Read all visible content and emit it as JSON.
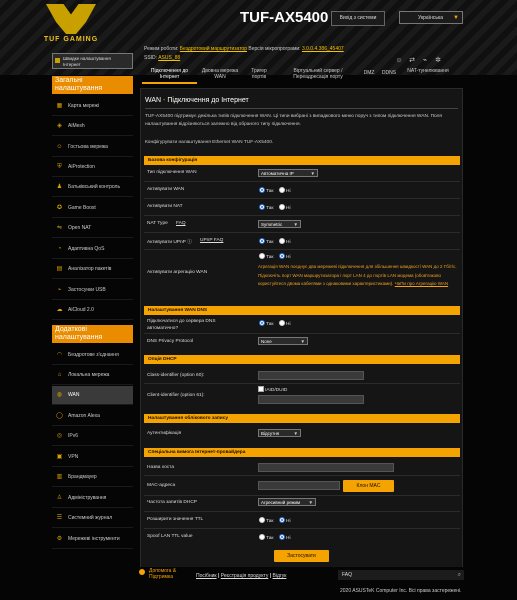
{
  "header": {
    "brand": "TUF GAMING",
    "model": "TUF-AX5400",
    "logout_label": "Вихід з системи",
    "language": "Українська",
    "mode_label": "Режим роботи:",
    "mode_value": "Бездротовий маршрутизатор",
    "fw_label": "Версія мікропрограми:",
    "fw_value": "3.0.0.4.386_45407",
    "ssid_label": "SSID:",
    "ssid_value": "ASUS_88"
  },
  "tabs": [
    {
      "label": "Підключення до Інтернет"
    },
    {
      "label": "Двовна мережа WAN"
    },
    {
      "label": "Тригер портів"
    },
    {
      "label": "Віртуальний сервер / Переадресація порту"
    },
    {
      "label": "DMZ"
    },
    {
      "label": "DDNS"
    },
    {
      "label": "NAT-тунелювання"
    }
  ],
  "sidebar": {
    "quick_setup": "Швидке налаштування Інтернет",
    "general_title": "Загальні налаштування",
    "general_items": [
      {
        "label": "Карта мережі",
        "icon": "map-icon"
      },
      {
        "label": "AiMesh",
        "icon": "mesh-icon"
      },
      {
        "label": "Гостьова мережа",
        "icon": "guest-icon"
      },
      {
        "label": "AiProtection",
        "icon": "shield-icon"
      },
      {
        "label": "Батьківський контроль",
        "icon": "parental-icon"
      },
      {
        "label": "Game Boost",
        "icon": "gamepad-icon"
      },
      {
        "label": "Open NAT",
        "icon": "nat-icon"
      },
      {
        "label": "Адаптивна QoS",
        "icon": "qos-icon"
      },
      {
        "label": "Аналізатор пакетів",
        "icon": "traffic-icon"
      },
      {
        "label": "Застосунки USB",
        "icon": "usb-icon"
      },
      {
        "label": "AiCloud 2.0",
        "icon": "cloud-icon"
      }
    ],
    "advanced_title": "Додаткові налаштування",
    "advanced_items": [
      {
        "label": "Бездротове з'єднання",
        "icon": "wireless-icon"
      },
      {
        "label": "Локальна мережа",
        "icon": "lan-icon"
      },
      {
        "label": "WAN",
        "icon": "globe-icon"
      },
      {
        "label": "Amazon Alexa",
        "icon": "alexa-icon"
      },
      {
        "label": "IPv6",
        "icon": "ipv6-icon"
      },
      {
        "label": "VPN",
        "icon": "vpn-icon"
      },
      {
        "label": "Брандмауер",
        "icon": "firewall-icon"
      },
      {
        "label": "Адміністрування",
        "icon": "admin-icon"
      },
      {
        "label": "Системний журнал",
        "icon": "log-icon"
      },
      {
        "label": "Мережеві інструменти",
        "icon": "tools-icon"
      }
    ]
  },
  "page": {
    "title_prefix": "WAN",
    "title_sep": " - ",
    "title": "Підключення до Інтернет",
    "desc": "TUF-AX5400 підтримує декілька типів підключення WAN. Ці типи вибрані з випадкового меню поруч з типом підключення WAN. Поля налаштування відрізняються залежно від обраного типу підключення.",
    "desc2": "Конфігурувати налаштування Ethernet WAN TUF-AX5400."
  },
  "basic": {
    "header": "Базова конфігурація",
    "wan_type_label": "Тип підключення WAN",
    "wan_type_value": "Автоматична IP",
    "enable_wan_label": "Активувати WAN",
    "enable_nat_label": "Активувати NAT",
    "nat_type_label": "NAT Type",
    "nat_faq": "FAQ",
    "nat_type_value": "Symmetric",
    "upnp_label": "Активувати UPnP",
    "upnp_faq": "UPnP FAQ",
    "aggregation_label": "Активувати агрегацію WAN",
    "yes": "Так",
    "no": "Ні",
    "note": "Агрегація WAN поєднує два мережеві підключення для збільшення швидкості WAN до 2 Гбіт/с. Підключіть порт WAN маршрутизатора і порт LAN 4 до портів LAN модема (обов'язково користуйтеся двома кабелями з однаковими характеристиками).",
    "note_link": "ЧаПи про Агрегацію WAN"
  },
  "dns": {
    "header": "Налаштування WAN DNS",
    "auto_label": "Підключатися до сервера DNS автоматично?",
    "privacy_label": "DNS Privacy Protocol",
    "privacy_value": "None"
  },
  "dhcp": {
    "header": "Опція DHCP",
    "class_id_label": "Class-identifier (option 60):",
    "client_id_label": "Client-identifier (option 61):",
    "iaid_label": "IAID/DUID"
  },
  "account": {
    "header": "Налаштування облікового запису",
    "auth_label": "Аутентифікація",
    "auth_value": "Відсутня"
  },
  "isp": {
    "header": "Спеціальна вимога Інтернет-провайдера",
    "host_label": "Назва хоста",
    "mac_label": "MAC-адреса",
    "mac_button": "Клон MAC",
    "dhcp_freq_label": "Частота запитів DHCP",
    "dhcp_freq_value": "Агресивний режим",
    "ttl_label": "Розширити значення TTL",
    "spoof_label": "Spoof LAN TTL value"
  },
  "apply_label": "Застосувати",
  "footer": {
    "help": "Допомога & Підтримка",
    "link1": "Посібник",
    "sep": " | ",
    "link2": "Реєстрація продукту",
    "link3": "Відгук",
    "faq": "FAQ",
    "copyright": "2020 ASUSTeK Computer Inc. Всі права застережені."
  },
  "colors": {
    "accent": "#f5a300",
    "background": "#050505",
    "panel": "#151515"
  }
}
